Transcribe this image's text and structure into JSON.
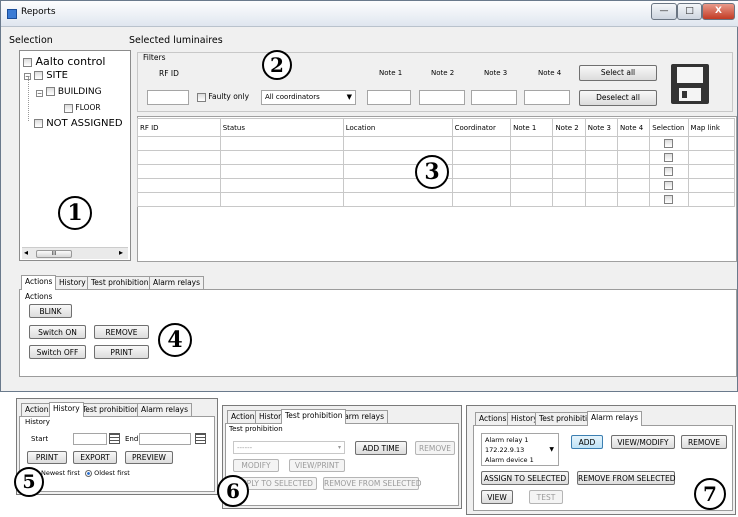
{
  "window": {
    "title": "Reports",
    "min_glyph": "—",
    "max_glyph": "□",
    "close_glyph": "X"
  },
  "selection": {
    "heading": "Selection",
    "tree": [
      {
        "label": "Aalto control"
      },
      {
        "label": "SITE"
      },
      {
        "label": "BUILDING"
      },
      {
        "label": "FLOOR"
      },
      {
        "label": "NOT ASSIGNED"
      }
    ],
    "scroll_glyph": "III",
    "scroll_left": "◂",
    "scroll_right": "▸"
  },
  "luminaires": {
    "heading": "Selected luminaires",
    "filters_label": "Filters",
    "rf_id_label": "RF ID",
    "faulty_only_label": "Faulty only",
    "coordinator_value": "All coordinators",
    "note_labels": [
      "Note 1",
      "Note 2",
      "Note 3",
      "Note 4"
    ],
    "select_all": "Select all",
    "deselect_all": "Deselect all",
    "save_icon": "floppy-disk"
  },
  "table": {
    "columns": [
      "RF ID",
      "Status",
      "Location",
      "Coordinator",
      "Note 1",
      "Note 2",
      "Note 3",
      "Note 4",
      "Selection",
      "Map link"
    ],
    "row_count": 5
  },
  "tabs": [
    "Actions",
    "History",
    "Test prohibition",
    "Alarm relays"
  ],
  "actions": {
    "group_label": "Actions",
    "blink": "BLINK",
    "switch_on": "Switch ON",
    "remove": "REMOVE",
    "switch_off": "Switch OFF",
    "print": "PRINT"
  },
  "history": {
    "group_label": "History",
    "start_label": "Start",
    "end_label": "End",
    "print": "PRINT",
    "export": "EXPORT",
    "preview": "PREVIEW",
    "newest_first": "Newest first",
    "oldest_first": "Oldest first"
  },
  "test_prohibition": {
    "group_label": "Test prohibition",
    "select_value": "------",
    "add_time": "ADD TIME",
    "remove": "REMOVE",
    "modify": "MODIFY",
    "view_print": "VIEW/PRINT",
    "apply": "APPLY TO SELECTED",
    "remove_from_selected": "REMOVE FROM SELECTED"
  },
  "alarm_relays": {
    "relay_lines": [
      "Alarm relay 1",
      "172.22.9.13",
      "Alarm device 1"
    ],
    "add": "ADD",
    "view_modify": "VIEW/MODIFY",
    "remove": "REMOVE",
    "assign": "ASSIGN TO SELECTED",
    "remove_from_selected": "REMOVE FROM SELECTED",
    "view": "VIEW",
    "test": "TEST"
  },
  "callouts": [
    "1",
    "2",
    "3",
    "4",
    "5",
    "6",
    "7"
  ]
}
